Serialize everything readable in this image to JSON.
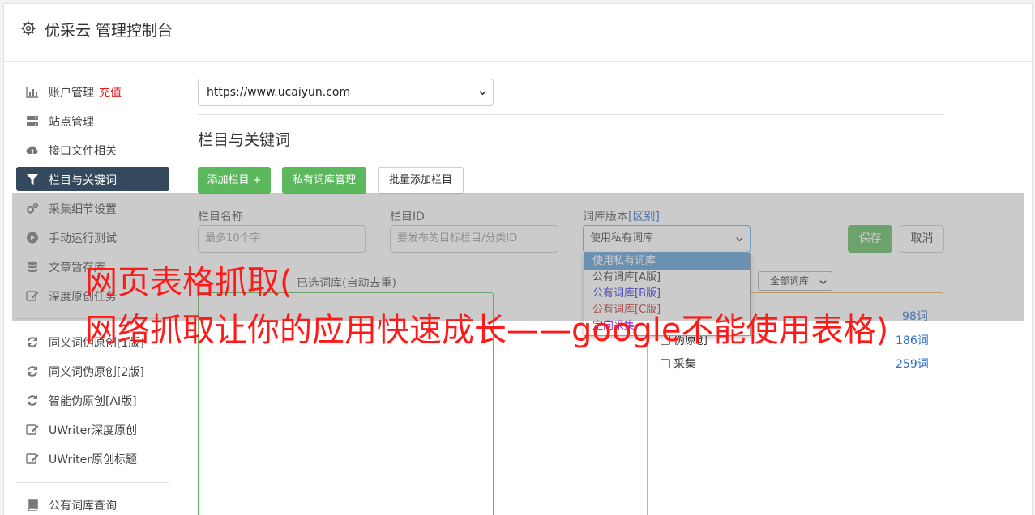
{
  "header": {
    "title": "优采云 管理控制台",
    "icon": "gear-icon"
  },
  "sidebar": {
    "items": [
      {
        "label": "账户管理",
        "extra": "充值",
        "icon": "bar-chart-icon"
      },
      {
        "label": "站点管理",
        "icon": "server-icon"
      },
      {
        "label": "接口文件相关",
        "icon": "cloud-upload-icon"
      },
      {
        "label": "栏目与关键词",
        "icon": "filter-icon",
        "active": true
      },
      {
        "label": "采集细节设置",
        "icon": "cogs-icon"
      },
      {
        "label": "手动运行测试",
        "icon": "play-circle-icon"
      },
      {
        "label": "文章暂存库",
        "icon": "database-icon"
      },
      {
        "label": "深度原创任务",
        "icon": "edit-icon"
      },
      {
        "label": "同义词伪原创[1版]",
        "icon": "refresh-icon"
      },
      {
        "label": "同义词伪原创[2版]",
        "icon": "refresh-icon"
      },
      {
        "label": "智能伪原创[AI版]",
        "icon": "refresh-icon"
      },
      {
        "label": "UWriter深度原创",
        "icon": "edit-icon"
      },
      {
        "label": "UWriter原创标题",
        "icon": "edit-icon"
      },
      {
        "label": "公有词库查询",
        "icon": "book-icon"
      }
    ]
  },
  "main": {
    "site_select": "https://www.ucaiyun.com",
    "section_title": "栏目与关键词",
    "buttons": {
      "add_column": "添加栏目 +",
      "private_lib": "私有词库管理",
      "batch_add": "批量添加栏目"
    },
    "form": {
      "name_label": "栏目名称",
      "name_placeholder": "最多10个字",
      "id_label": "栏目ID",
      "id_placeholder": "要发布的目标栏目/分类ID",
      "lib_label": "词库版本",
      "lib_label_link": "[区别]",
      "lib_selected": "使用私有词库",
      "save": "保存",
      "cancel": "取消"
    },
    "selected_label": "已选词库(自动去重)",
    "all_libs": "全部词库",
    "lib_options": [
      "使用私有词库",
      "公有词库[A版]",
      "公有词库[B版]",
      "公有词库[C版]",
      "定向采集"
    ],
    "lib_list": [
      {
        "name": "伪原创",
        "count": "186词"
      },
      {
        "name": "采集",
        "count": "259词"
      }
    ],
    "partial_count": "98词"
  },
  "watermark": {
    "line1": "网页表格抓取(",
    "line2": "网络抓取让你的应用快速成长——google不能使用表格)"
  },
  "colors": {
    "accent_green": "#5cb85c",
    "active_nav": "#34495e",
    "warn_orange": "#f0ad4e",
    "link_blue": "#2a6fc9",
    "watermark_red": "#ff1a1a"
  }
}
